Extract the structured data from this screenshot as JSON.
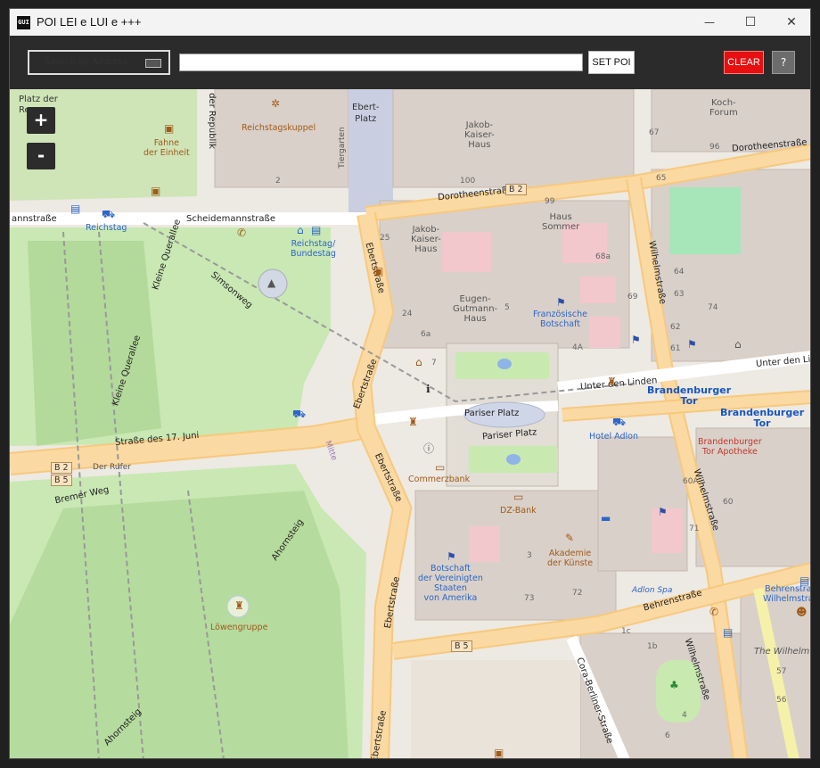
{
  "window": {
    "app_icon": "GUI",
    "title": "POI LEI e LUI e +++",
    "controls": {
      "minimize": "—",
      "maximize": "☐",
      "close": "✕"
    }
  },
  "toolbar": {
    "search_button_label": "Search by Address",
    "address_value": "",
    "set_poi_label": "SET POI",
    "clear_label": "CLEAR",
    "help_label": "?"
  },
  "map": {
    "zoom_in": "+",
    "zoom_out": "-",
    "streets": {
      "dorotheenstrasse_top": "Dorotheenstraße",
      "dorotheenstrasse_mid": "Dorotheenstraße",
      "scheidemannstrasse": "Scheidemannstraße",
      "scheidemann_left": "annstraße",
      "simsonweg": "Simsonweg",
      "kleine_querallee_top": "Kleine Querallee",
      "kleine_querallee_bottom": "Kleine Querallee",
      "strasse_17_juni": "Straße des 17. Juni",
      "bremer_weg": "Bremer Weg",
      "ahornsteig_top": "Ahornsteig",
      "ahornsteig_bottom": "Ahornsteig",
      "ebertstrasse_1": "Ebertstraße",
      "ebertstrasse_2": "Ebertstraße",
      "ebertstrasse_3": "Ebertstraße",
      "ebertstrasse_4": "Ebertstraße",
      "ebertstrasse_5": "Ebertstraße",
      "wilhelmstrasse_1": "Wilhelmstraße",
      "wilhelmstrasse_2": "Wilhelmstraße",
      "wilhelmstrasse_3": "Wilhelmstraße",
      "unter_den_linden_1": "Unter den Linden",
      "unter_den_linden_2": "Unter den Lin",
      "pariser_platz_1": "Pariser Platz",
      "pariser_platz_2": "Pariser Platz",
      "behrenstrasse": "Behrenstraße",
      "cora_berliner": "Cora-Berliner-Straße",
      "platz_der_republik": "der Republik",
      "tiergarten": "Tiergarten",
      "mitte": "Mitte"
    },
    "refs": {
      "b2_top": "B 2",
      "b2_left": "B 2",
      "b5_left": "B 5",
      "b5_bottom": "B 5"
    },
    "places": {
      "platz_der": "Platz der",
      "platz_re": "Re",
      "reichstagskuppel": "Reichstagskuppel",
      "fahne": "Fahne\nder Einheit",
      "reichstag": "Reichstag",
      "reichstag_bundestag": "Reichstag/\nBundestag",
      "ebert_platz": "Ebert-\nPlatz",
      "jakob_kaiser_haus_top": "Jakob-\nKaiser-\nHaus",
      "jakob_kaiser_haus_mid": "Jakob-\nKaiser-\nHaus",
      "koch_forum": "Koch-\nForum",
      "haus_sommer": "Haus\nSommer",
      "eugen_gutmann_haus": "Eugen-\nGutmann-\nHaus",
      "franzoesische_botschaft": "Französische\nBotschaft",
      "brandenburger_tor_1": "Brandenburger\nTor",
      "brandenburger_tor_2": "Brandenburger\nTor",
      "hotel_adlon": "Hotel Adlon",
      "brandenburger_tor_apotheke": "Brandenburger\nTor Apotheke",
      "commerzbank": "Commerzbank",
      "dz_bank": "DZ-Bank",
      "akademie": "Akademie\nder Künste",
      "botschaft_usa": "Botschaft\nder Vereinigten\nStaaten\nvon Amerika",
      "der_rufer": "Der Rufer",
      "loewengruppe": "Löwengruppe",
      "adlon_spa": "Adlon Spa",
      "behrenstr_right": "Behrenstra\nWilhelmstra",
      "the_wilhelm": "The Wilhelm"
    },
    "house_numbers": [
      "2",
      "100",
      "96",
      "67",
      "65",
      "99",
      "68a",
      "25",
      "64",
      "69",
      "24",
      "5",
      "6a",
      "7",
      "63",
      "74",
      "61",
      "62",
      "4A",
      "3",
      "73",
      "72",
      "71",
      "60",
      "60A",
      "1c",
      "1b",
      "4",
      "57",
      "56",
      "6",
      "5",
      "2"
    ]
  }
}
